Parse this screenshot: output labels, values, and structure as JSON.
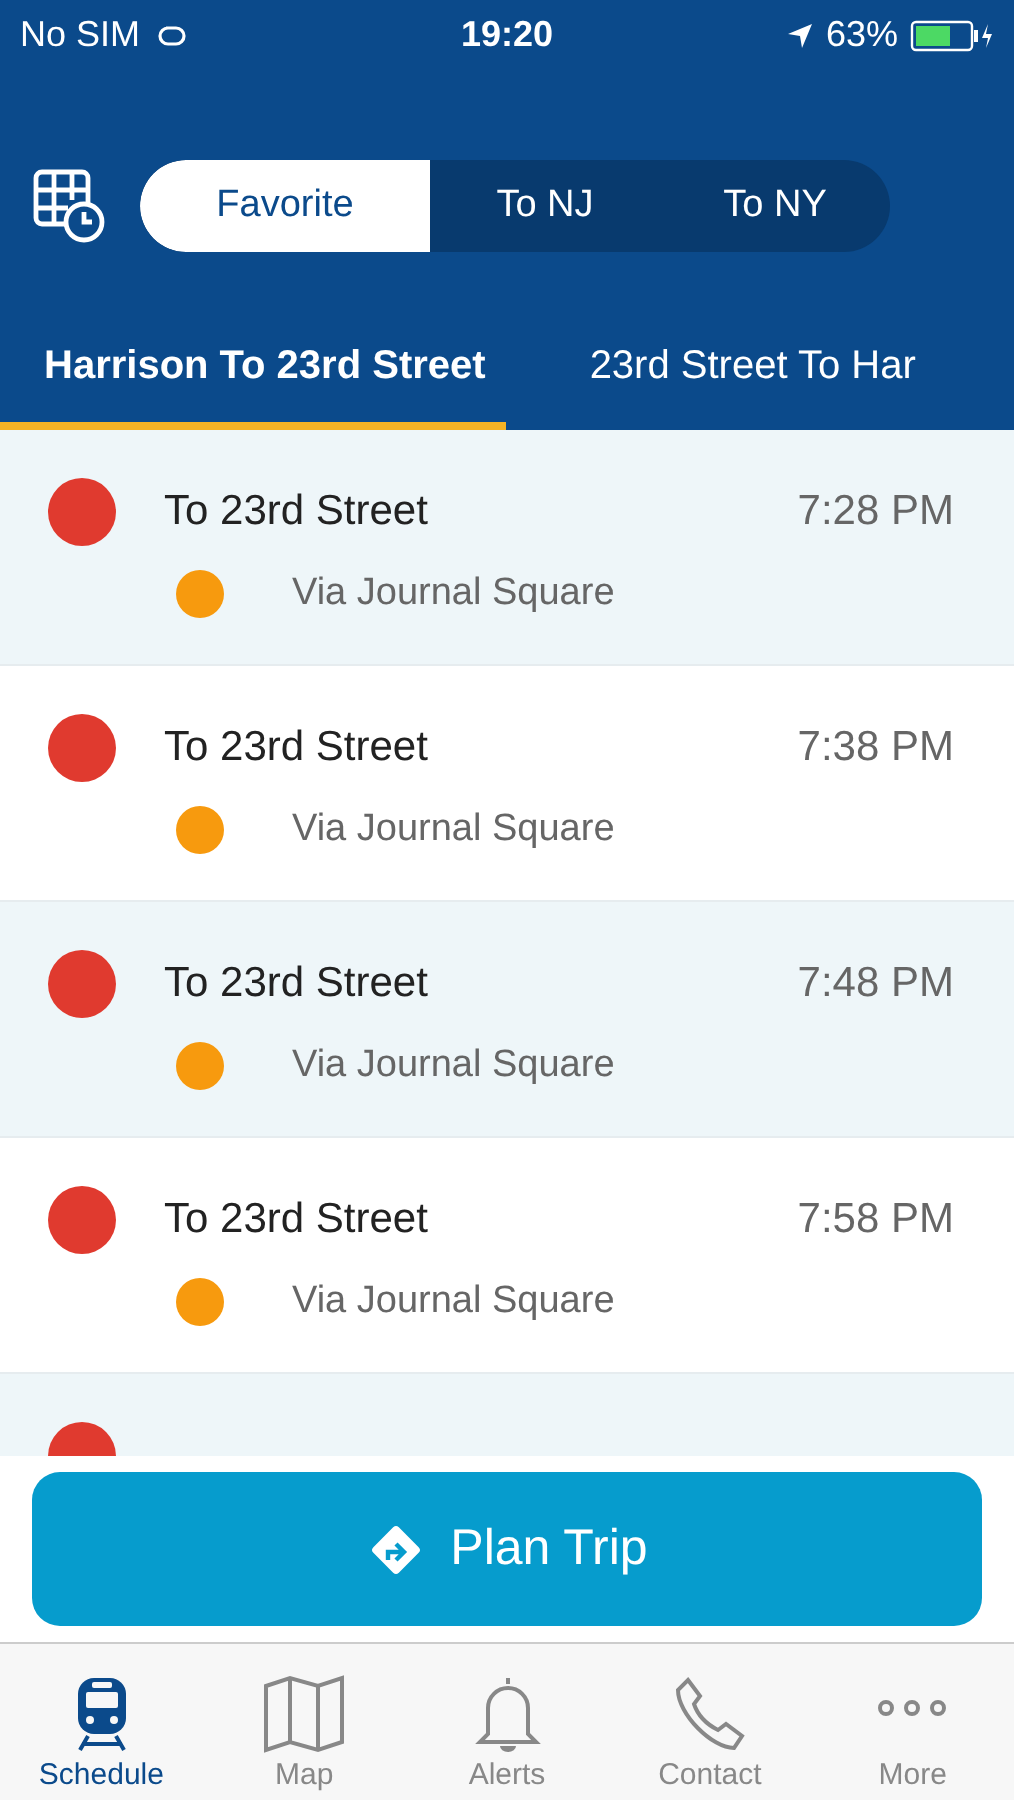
{
  "status_bar": {
    "carrier": "No SIM",
    "time": "19:20",
    "battery": "63%"
  },
  "segments": [
    {
      "label": "Favorite",
      "selected": true
    },
    {
      "label": "To NJ",
      "selected": false
    },
    {
      "label": "To NY",
      "selected": false
    }
  ],
  "route_tabs": [
    {
      "label": "Harrison To 23rd Street",
      "selected": true
    },
    {
      "label": "23rd Street To Har",
      "selected": false
    }
  ],
  "trips": [
    {
      "destination": "To 23rd Street",
      "color": "#e03a2f",
      "via": {
        "label": "Via Journal Square",
        "color": "#f79a0e"
      },
      "time": "7:28 PM"
    },
    {
      "destination": "To 23rd Street",
      "color": "#e03a2f",
      "via": {
        "label": "Via Journal Square",
        "color": "#f79a0e"
      },
      "time": "7:38 PM"
    },
    {
      "destination": "To 23rd Street",
      "color": "#e03a2f",
      "via": {
        "label": "Via Journal Square",
        "color": "#f79a0e"
      },
      "time": "7:48 PM"
    },
    {
      "destination": "To 23rd Street",
      "color": "#e03a2f",
      "via": {
        "label": "Via Journal Square",
        "color": "#f79a0e"
      },
      "time": "7:58 PM"
    },
    {
      "color": "#e03a2f"
    }
  ],
  "plan_button": "Plan Trip",
  "nav": [
    {
      "label": "Schedule",
      "kind": "train",
      "selected": true
    },
    {
      "label": "Map",
      "kind": "map",
      "selected": false
    },
    {
      "label": "Alerts",
      "kind": "bell",
      "selected": false
    },
    {
      "label": "Contact",
      "kind": "phone",
      "selected": false
    },
    {
      "label": "More",
      "kind": "more",
      "selected": false
    }
  ]
}
